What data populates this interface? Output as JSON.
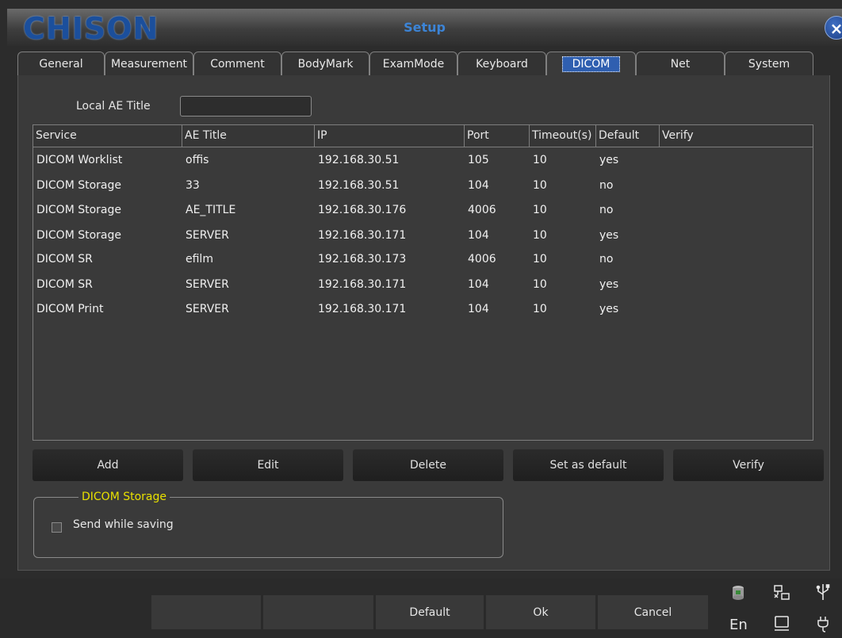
{
  "window": {
    "logo": "CHISON",
    "title": "Setup",
    "close_label": "×"
  },
  "tabs": [
    {
      "label": "General"
    },
    {
      "label": "Measurement"
    },
    {
      "label": "Comment"
    },
    {
      "label": "BodyMark"
    },
    {
      "label": "ExamMode"
    },
    {
      "label": "Keyboard"
    },
    {
      "label": "DICOM",
      "active": true
    },
    {
      "label": "Net"
    },
    {
      "label": "System"
    }
  ],
  "local_ae": {
    "label": "Local AE Title",
    "value": ""
  },
  "table": {
    "headers": [
      "Service",
      "AE Title",
      "IP",
      "Port",
      "Timeout(s)",
      "Default",
      "Verify"
    ],
    "rows": [
      [
        "DICOM Worklist",
        "offis",
        "192.168.30.51",
        "105",
        "10",
        "yes",
        ""
      ],
      [
        "DICOM Storage",
        "33",
        "192.168.30.51",
        "104",
        "10",
        "no",
        ""
      ],
      [
        "DICOM Storage",
        "AE_TITLE",
        "192.168.30.176",
        "4006",
        "10",
        "no",
        ""
      ],
      [
        "DICOM Storage",
        "SERVER",
        "192.168.30.171",
        "104",
        "10",
        "yes",
        ""
      ],
      [
        "DICOM SR",
        "efilm",
        "192.168.30.173",
        "4006",
        "10",
        "no",
        ""
      ],
      [
        "DICOM SR",
        "SERVER",
        "192.168.30.171",
        "104",
        "10",
        "yes",
        ""
      ],
      [
        "DICOM Print",
        "SERVER",
        "192.168.30.171",
        "104",
        "10",
        "yes",
        ""
      ]
    ]
  },
  "actions": {
    "add": "Add",
    "edit": "Edit",
    "delete": "Delete",
    "set_default": "Set as default",
    "verify": "Verify"
  },
  "storage_group": {
    "title": "DICOM Storage",
    "send_while_saving": {
      "label": "Send while saving",
      "checked": false
    }
  },
  "bottom": {
    "blank1": "",
    "blank2": "",
    "default": "Default",
    "ok": "Ok",
    "cancel": "Cancel"
  },
  "status": {
    "language": "En",
    "icons": [
      "disk-icon",
      "network-icon",
      "usb-icon",
      "monitor-icon",
      "power-plug-icon"
    ]
  },
  "colors": {
    "accent_title": "#3c84d6",
    "group_title": "#e8e000",
    "logo": "#1b4f9c"
  }
}
